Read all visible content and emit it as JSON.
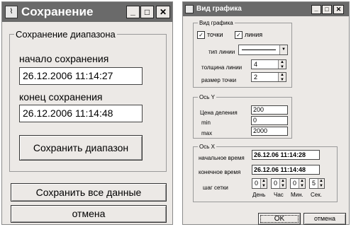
{
  "left_window": {
    "title": "Сохранение",
    "controls": {
      "minimize": "_",
      "maximize": "□",
      "close": "✕"
    },
    "group_title": "Сохранение диапазона",
    "start_label": "начало сохранения",
    "start_value": "26.12.2006 11:14:27",
    "end_label": "конец сохранения",
    "end_value": "26.12.2006 11:14:48",
    "save_range_button": "Сохранить диапазон",
    "save_all_button": "Сохранить все данные",
    "cancel_button": "отмена"
  },
  "right_window": {
    "title": "Вид графика",
    "controls": {
      "minimize": "_",
      "maximize": "□",
      "close": "✕"
    },
    "view_group": {
      "title": "Вид графика",
      "points_label": "точки",
      "points_checked": true,
      "line_label": "линия",
      "line_checked": true,
      "line_type_label": "тип линии",
      "line_width_label": "толщина линии",
      "line_width_value": "4",
      "point_size_label": "размер точки",
      "point_size_value": "2"
    },
    "y_group": {
      "title": "Ось Y",
      "division_label": "Цена деления",
      "division_value": "200",
      "min_label": "min",
      "min_value": "0",
      "max_label": "max",
      "max_value": "2000"
    },
    "x_group": {
      "title": "Ось X",
      "start_time_label": "начальное время",
      "start_time_value": "26.12.06 11:14:28",
      "end_time_label": "конечное время",
      "end_time_value": "26.12.06 11:14:48",
      "grid_step_label": "шаг сетки",
      "spinners": [
        {
          "value": "0",
          "label": "День"
        },
        {
          "value": "0",
          "label": "Час"
        },
        {
          "value": "0",
          "label": "Мин."
        },
        {
          "value": "5",
          "label": "Сек."
        }
      ]
    },
    "ok_button": "OK",
    "cancel_button": "отмена"
  },
  "icons": {
    "checkbox_mark": "✓",
    "spin_up": "▲",
    "spin_down": "▼",
    "dropdown": "▼"
  },
  "colors": {
    "titlebar": "#6a6a6a",
    "window_bg": "#ece9e6",
    "field_bg": "#ffffff"
  }
}
